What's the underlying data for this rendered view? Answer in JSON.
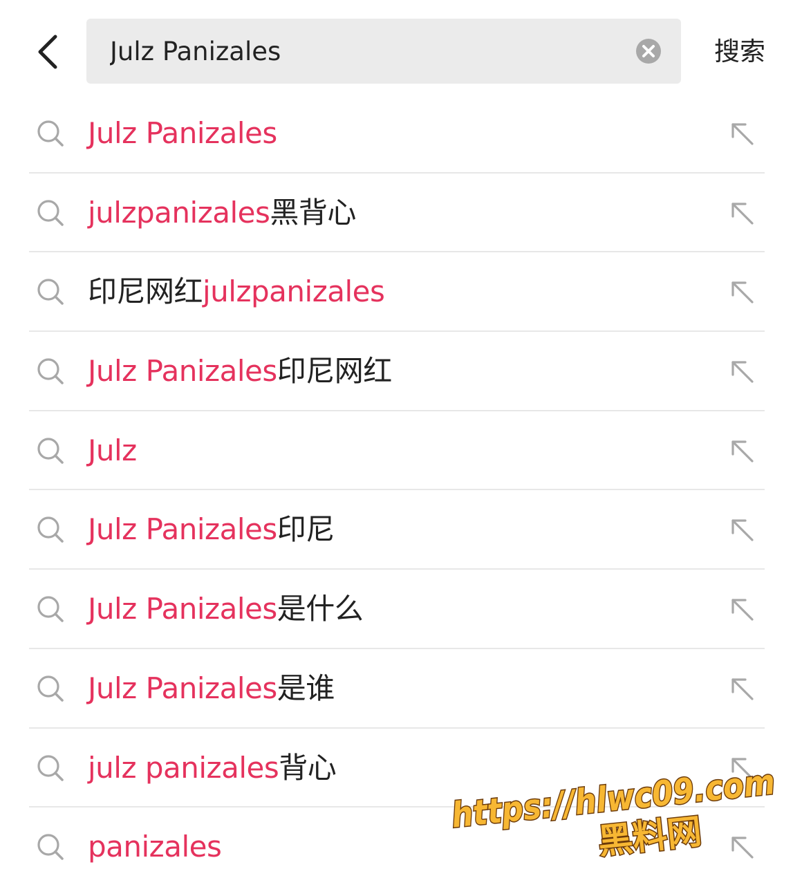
{
  "header": {
    "back_icon": "chevron-left-icon",
    "search_value": "Julz Panizales",
    "clear_icon": "clear-circle-icon",
    "search_button_label": "搜索"
  },
  "suggestions": [
    {
      "highlight": "Julz Panizales",
      "rest": ""
    },
    {
      "highlight": "julzpanizales",
      "rest": "黑背心"
    },
    {
      "prefix": "印尼网红",
      "highlight": "julzpanizales",
      "rest": ""
    },
    {
      "highlight": "Julz Panizales",
      "rest": "印尼网红"
    },
    {
      "highlight": "Julz",
      "rest": ""
    },
    {
      "highlight": "Julz Panizales",
      "rest": "印尼"
    },
    {
      "highlight": "Julz Panizales",
      "rest": "是什么"
    },
    {
      "highlight": "Julz Panizales",
      "rest": "是谁"
    },
    {
      "highlight": "julz panizales",
      "rest": "背心"
    },
    {
      "highlight": "panizales",
      "rest": ""
    }
  ],
  "watermark": {
    "url": "https://hlwc09.com",
    "name": "黑料网"
  },
  "colors": {
    "highlight": "#e5325d",
    "text": "#222222",
    "icon_gray": "#a8a8a8",
    "search_bg": "#ebebeb",
    "watermark_fill": "#f7b733"
  }
}
